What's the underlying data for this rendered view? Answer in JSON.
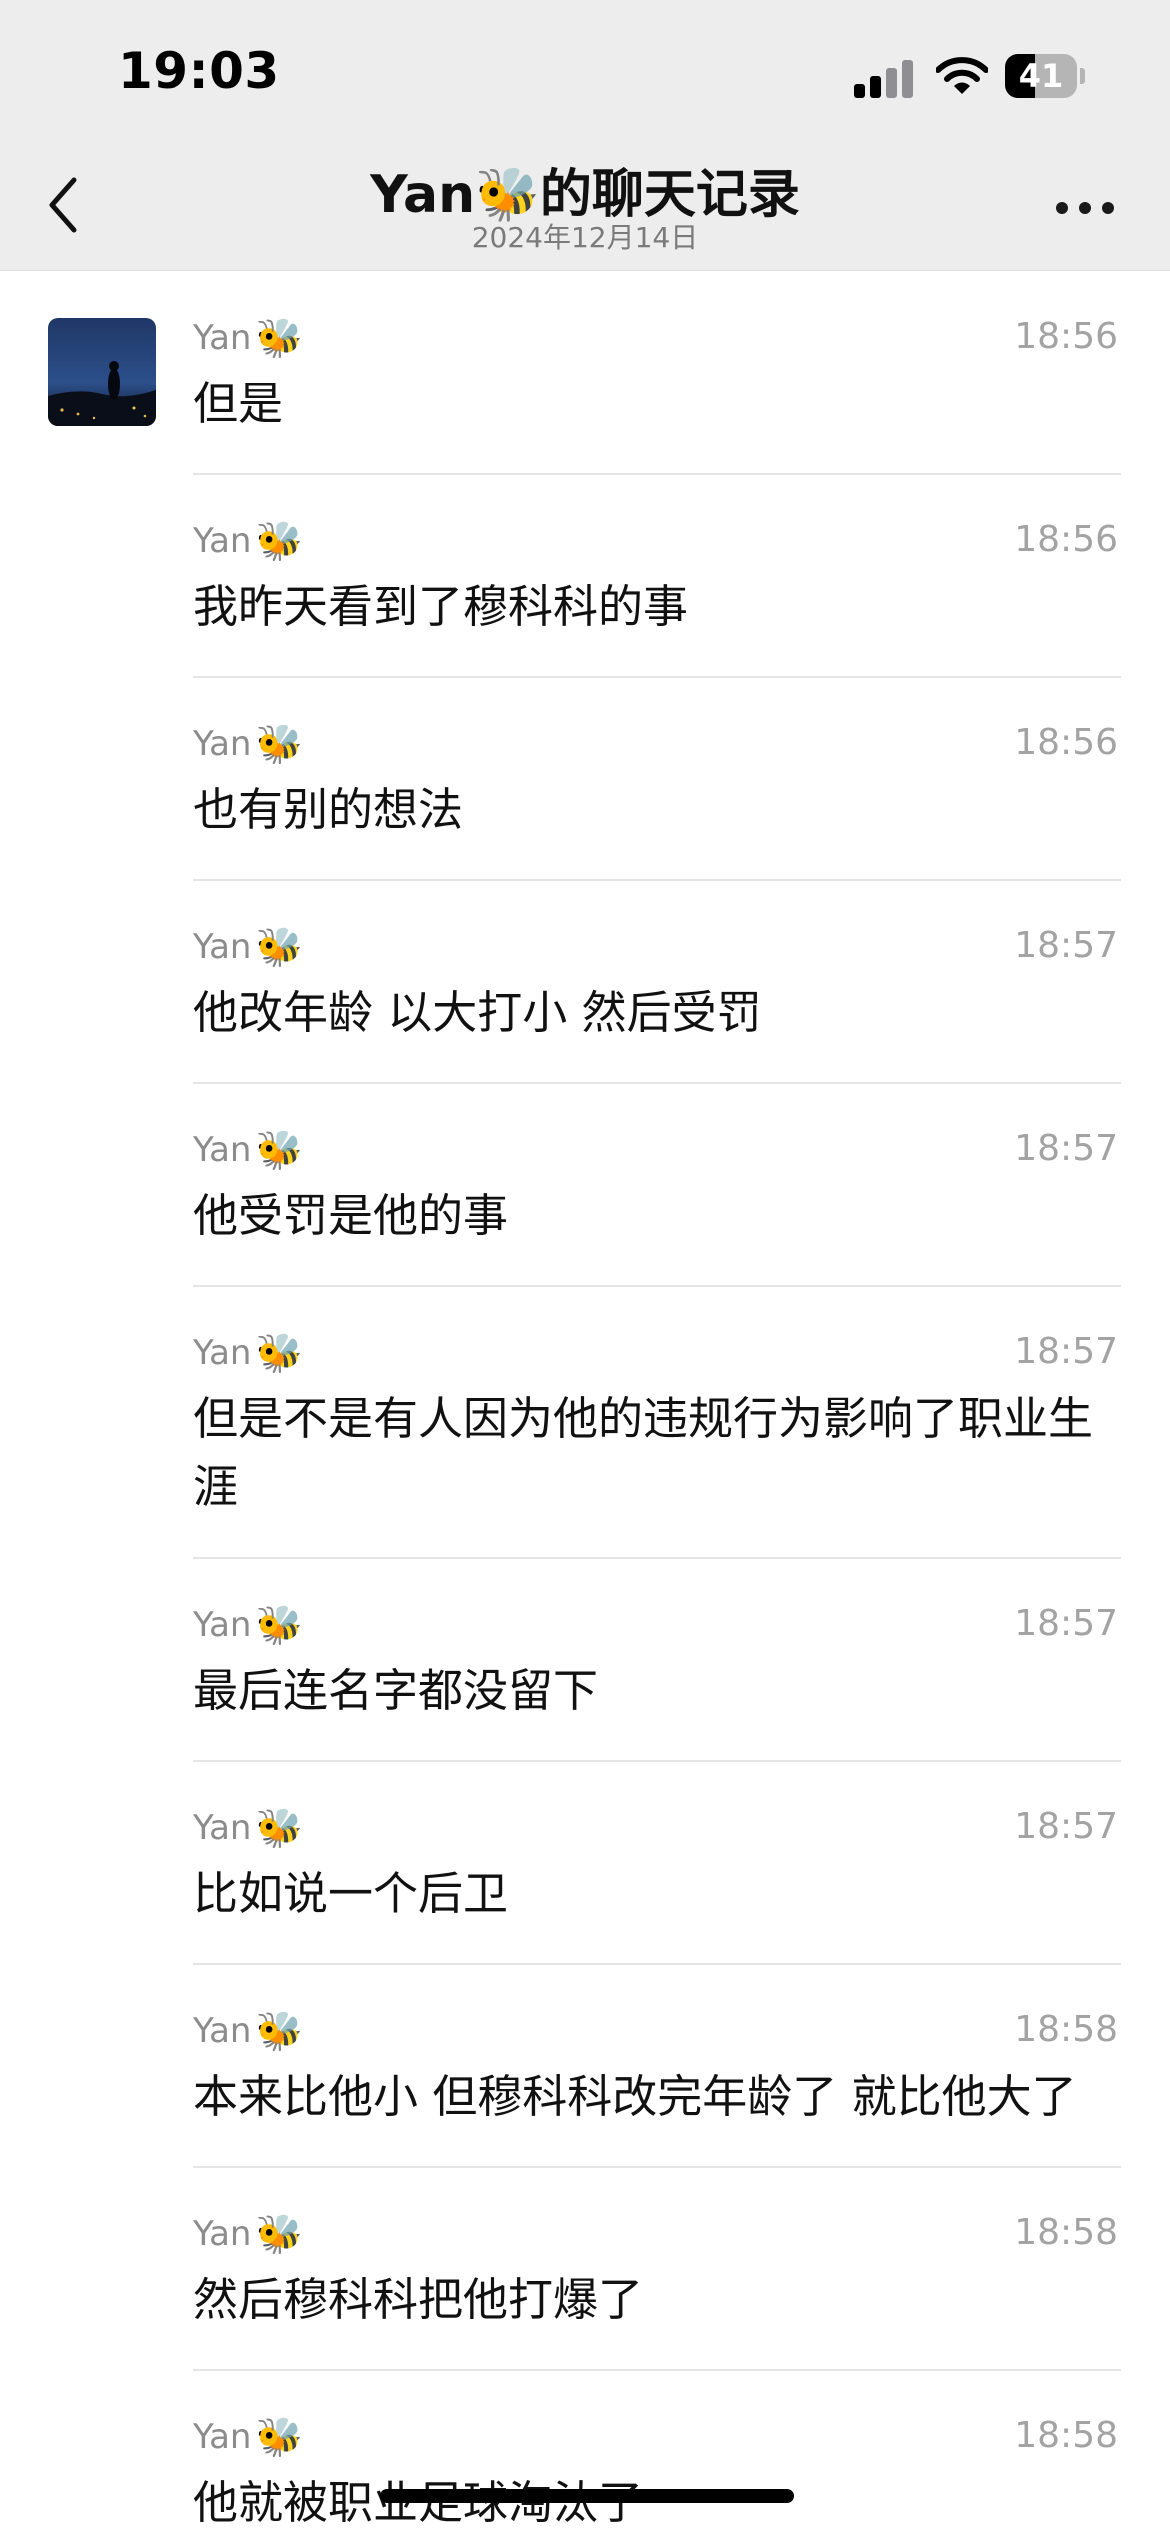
{
  "status_bar": {
    "time": "19:03",
    "battery_level": "41",
    "battery_fraction": 0.41
  },
  "nav": {
    "title": "Yan🐝的聊天记录",
    "subtitle": "2024年12月14日"
  },
  "icons": {
    "back": "chevron-left-icon",
    "more": "more-dots-icon",
    "signal": "cellular-signal-icon",
    "wifi": "wifi-icon",
    "battery": "battery-icon"
  },
  "messages": [
    {
      "sender": "Yan",
      "emoji": "🐝",
      "time": "18:56",
      "text": "但是"
    },
    {
      "sender": "Yan",
      "emoji": "🐝",
      "time": "18:56",
      "text": "我昨天看到了穆科科的事"
    },
    {
      "sender": "Yan",
      "emoji": "🐝",
      "time": "18:56",
      "text": "也有别的想法"
    },
    {
      "sender": "Yan",
      "emoji": "🐝",
      "time": "18:57",
      "text": "他改年龄 以大打小 然后受罚"
    },
    {
      "sender": "Yan",
      "emoji": "🐝",
      "time": "18:57",
      "text": "他受罚是他的事"
    },
    {
      "sender": "Yan",
      "emoji": "🐝",
      "time": "18:57",
      "text": "但是不是有人因为他的违规行为影响了职业生涯"
    },
    {
      "sender": "Yan",
      "emoji": "🐝",
      "time": "18:57",
      "text": "最后连名字都没留下"
    },
    {
      "sender": "Yan",
      "emoji": "🐝",
      "time": "18:57",
      "text": "比如说一个后卫"
    },
    {
      "sender": "Yan",
      "emoji": "🐝",
      "time": "18:58",
      "text": "本来比他小 但穆科科改完年龄了 就比他大了"
    },
    {
      "sender": "Yan",
      "emoji": "🐝",
      "time": "18:58",
      "text": "然后穆科科把他打爆了"
    },
    {
      "sender": "Yan",
      "emoji": "🐝",
      "time": "18:58",
      "text": "他就被职业足球淘汰了"
    }
  ]
}
